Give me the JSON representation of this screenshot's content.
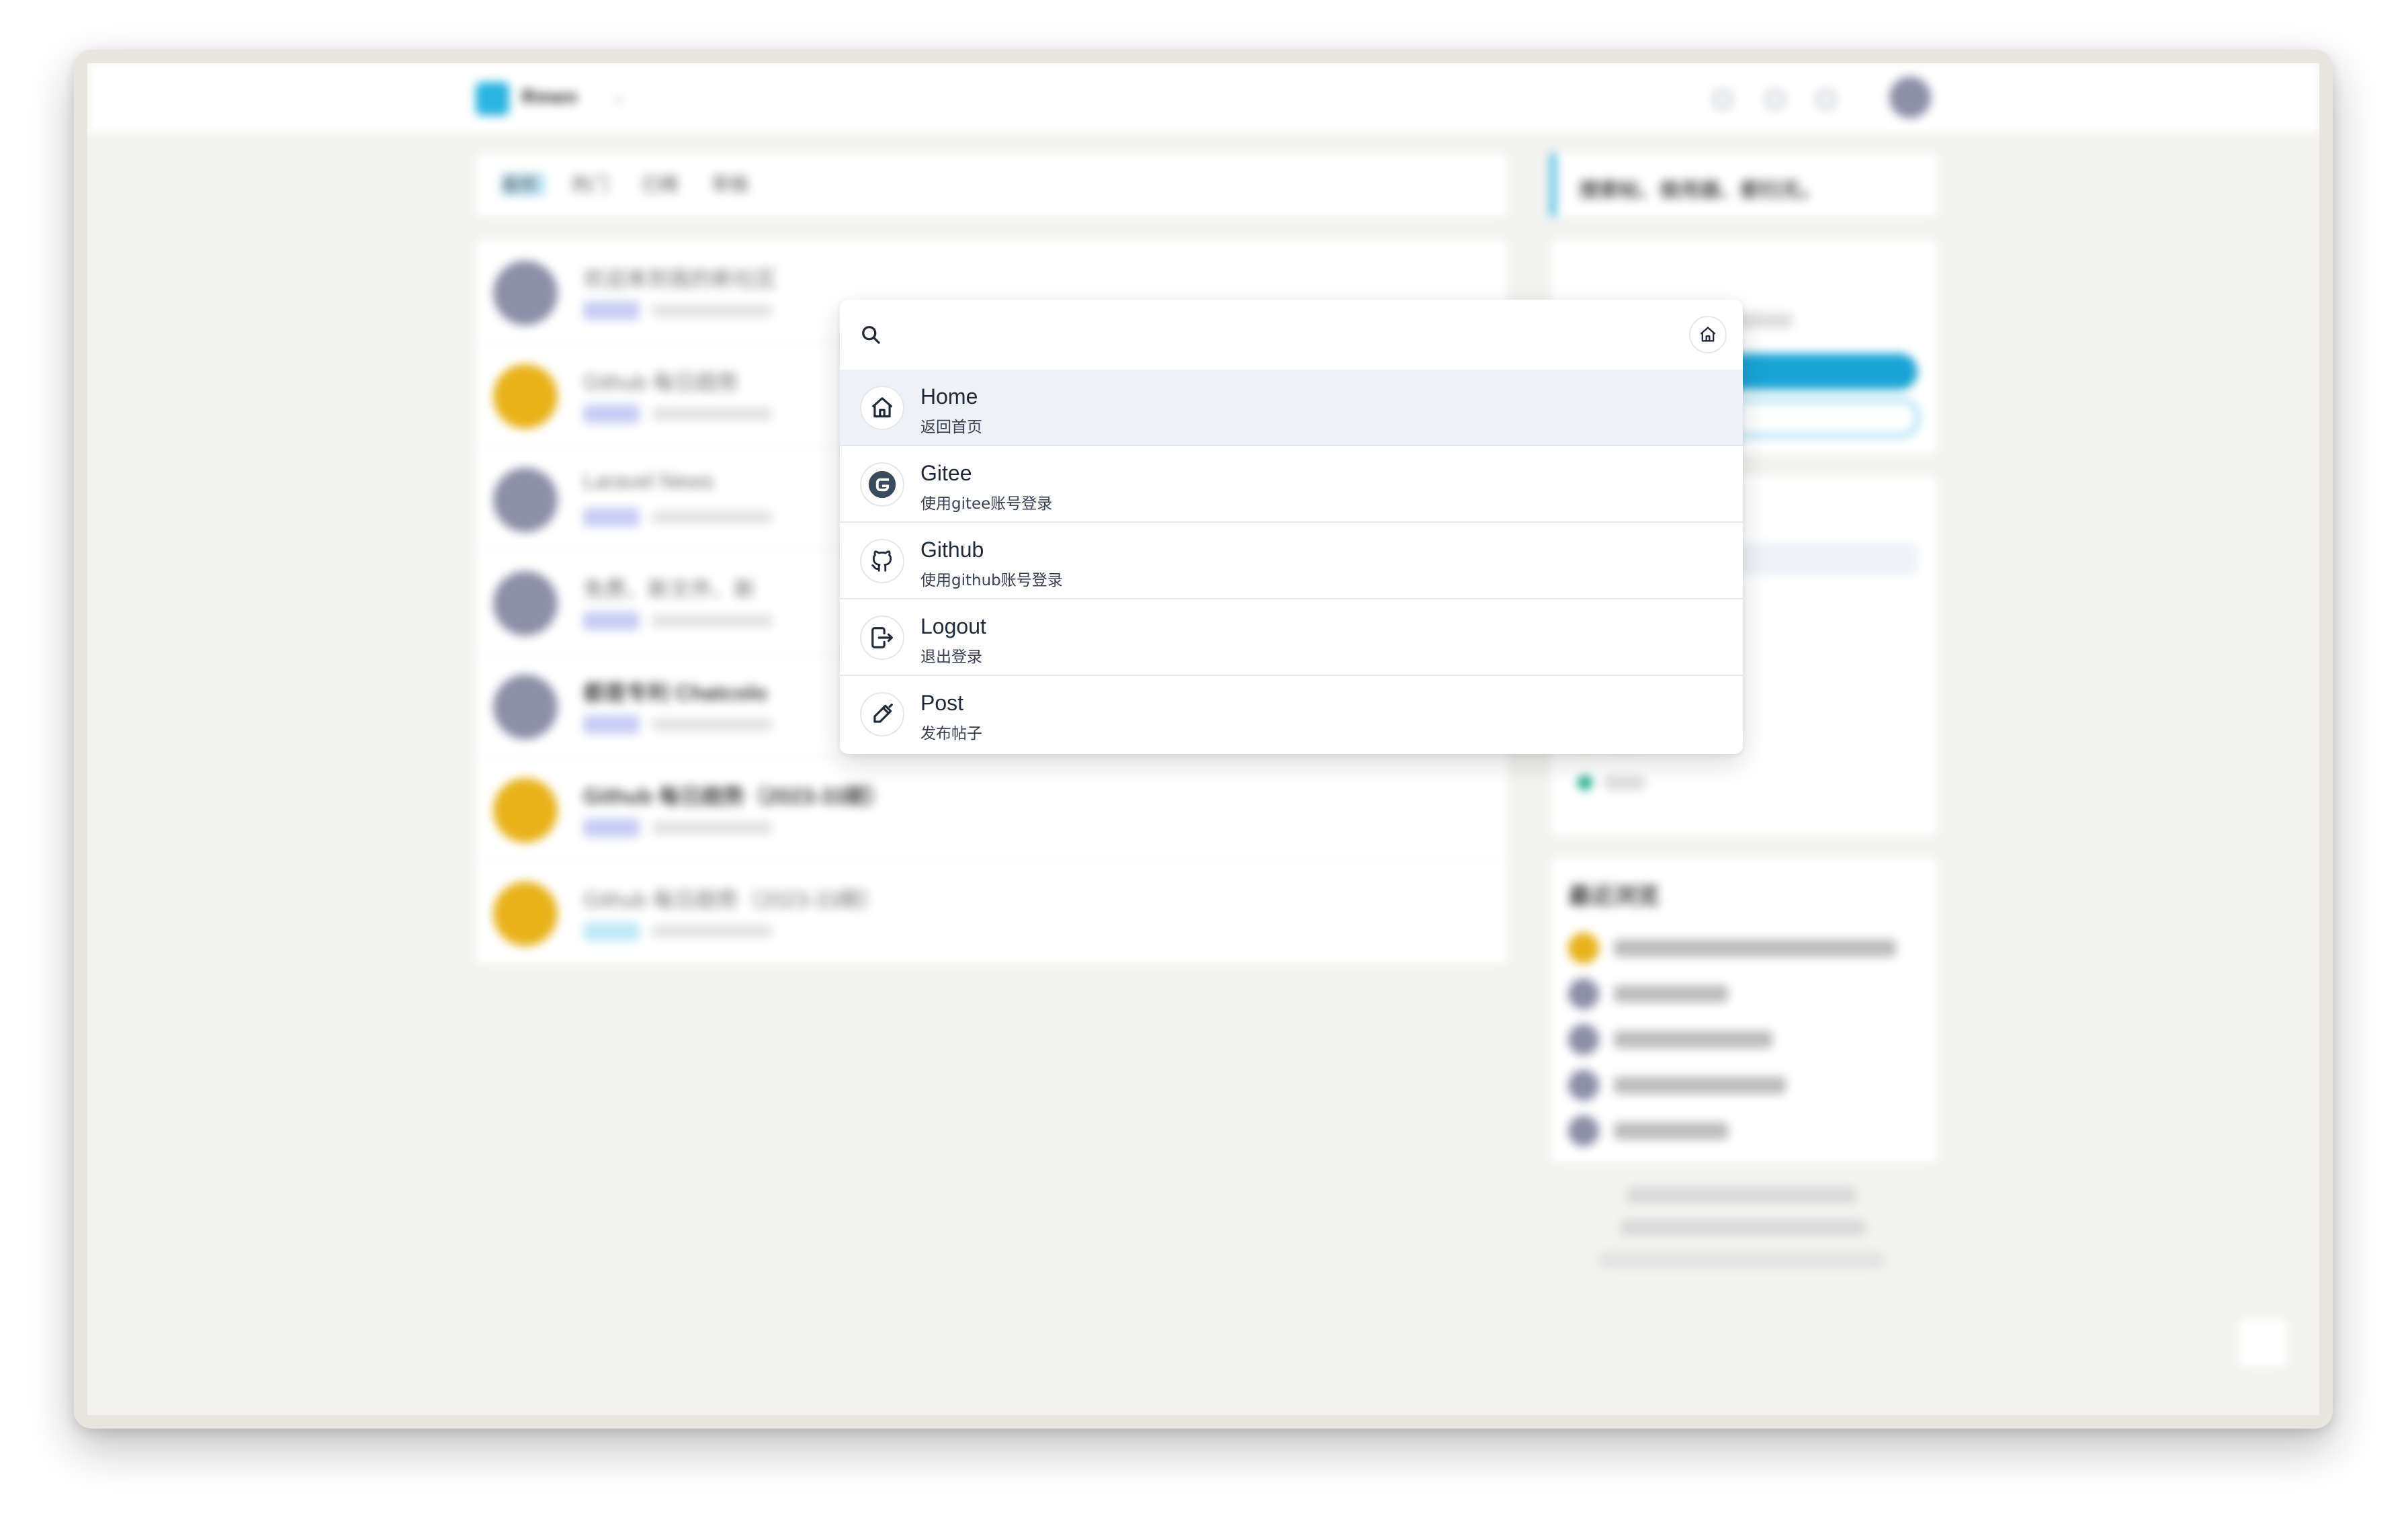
{
  "palette": {
    "search": {
      "value": "",
      "placeholder": ""
    },
    "home_button_icon": "home-icon",
    "commands": [
      {
        "title": "Home",
        "subtitle": "返回首页",
        "icon": "home-icon"
      },
      {
        "title": "Gitee",
        "subtitle": "使用gitee账号登录",
        "icon": "gitee-icon"
      },
      {
        "title": "Github",
        "subtitle": "使用github账号登录",
        "icon": "github-icon"
      },
      {
        "title": "Logout",
        "subtitle": "退出登录",
        "icon": "logout-icon"
      },
      {
        "title": "Post",
        "subtitle": "发布帖子",
        "icon": "pen-icon"
      }
    ]
  },
  "background_page": {
    "brand": "Rmen",
    "tabs": [
      "最新",
      "热门",
      "已精",
      "草稿"
    ],
    "sidebar_search_text": "搜索帖、做用器、都扫无。",
    "recent_title": "最近浏览",
    "posts": [
      {
        "title": "欢迎来到我的新社区"
      },
      {
        "title": "Github 每日趋势"
      },
      {
        "title": "Laravel News"
      },
      {
        "title": "免费、新文件、新"
      },
      {
        "title": "都是专利 Chatcolo"
      },
      {
        "title": "Github 每日趋势（2023-33期）"
      },
      {
        "title": "Github 每日趋势（2023-33期）"
      }
    ],
    "colors": {
      "accent": "#2ab4e0",
      "active_row": "#eef1f7",
      "divider": "#e5e7eb"
    }
  }
}
